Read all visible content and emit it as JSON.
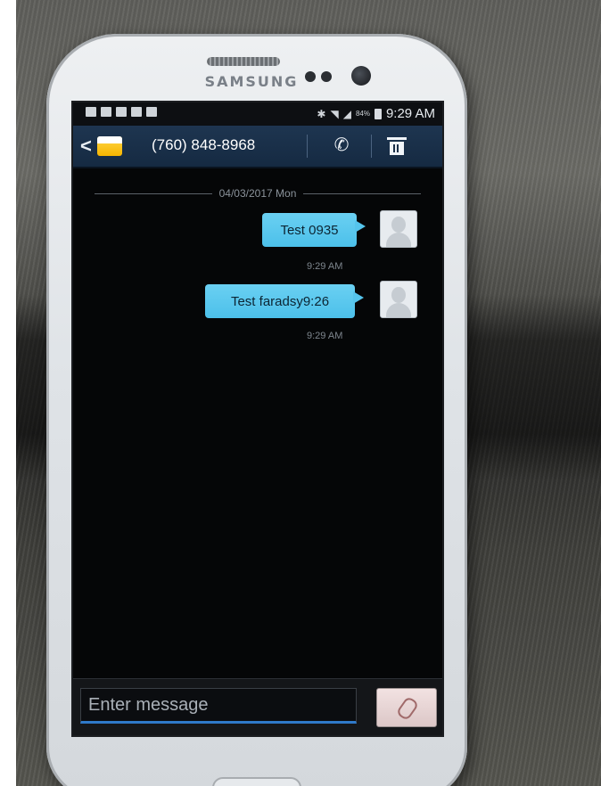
{
  "device": {
    "brand": "SAMSUNG"
  },
  "status_bar": {
    "battery_percent": "84%",
    "time": "9:29 AM"
  },
  "conversation": {
    "contact": "(760) 848-8968",
    "date_separator": "04/03/2017 Mon",
    "messages": [
      {
        "text": "Test 0935",
        "time": "9:29 AM",
        "direction": "outgoing"
      },
      {
        "text": "Test faradsy9:26",
        "time": "9:29 AM",
        "direction": "outgoing"
      }
    ]
  },
  "composer": {
    "placeholder": "Enter message"
  },
  "colors": {
    "action_bar": "#1e3550",
    "bubble": "#5cc8ef",
    "input_underline": "#2f79c9"
  },
  "icons": {
    "back": "chevron-left-icon",
    "app": "messages-app-icon",
    "call": "phone-icon",
    "delete": "trash-icon",
    "attach": "paperclip-icon",
    "avatar": "contact-avatar-icon"
  }
}
